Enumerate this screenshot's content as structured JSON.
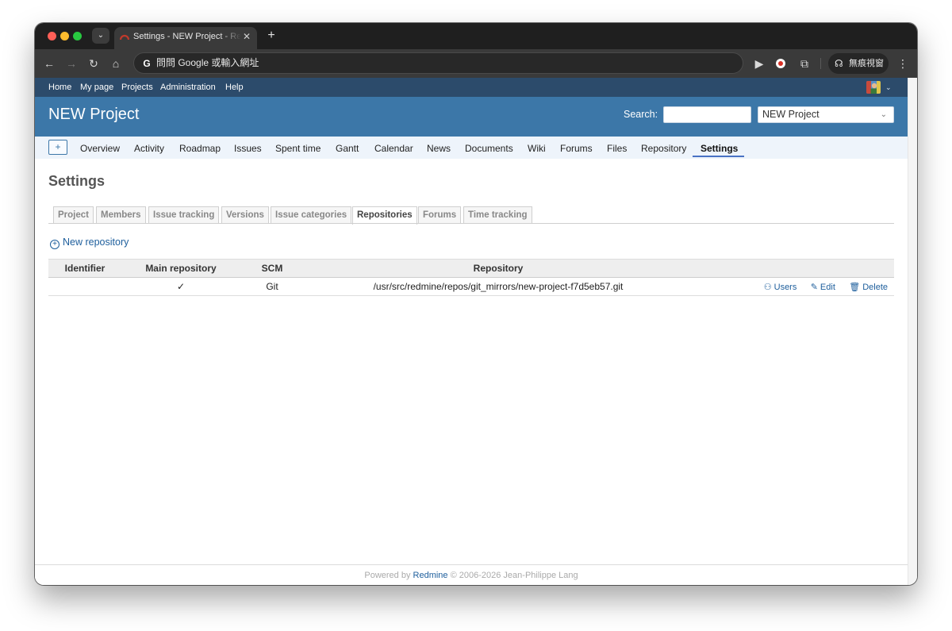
{
  "browser": {
    "tab_title": "Settings - NEW Project - Redmine",
    "tab_close": "✕",
    "new_tab": "+",
    "omnibox_placeholder": "問問 Google 或輸入網址",
    "incognito_label": "無痕視窗"
  },
  "topmenu": {
    "items": [
      "Home",
      "My page",
      "Projects",
      "Administration",
      "Help"
    ]
  },
  "header": {
    "project_title": "NEW Project",
    "search_label": "Search:",
    "search_value": "",
    "project_select_value": "NEW Project"
  },
  "mainmenu": {
    "plus_label": "+",
    "items": [
      "Overview",
      "Activity",
      "Roadmap",
      "Issues",
      "Spent time",
      "Gantt",
      "Calendar",
      "News",
      "Documents",
      "Wiki",
      "Forums",
      "Files",
      "Repository",
      "Settings"
    ],
    "selected": "Settings"
  },
  "content": {
    "title": "Settings",
    "tabs": [
      "Project",
      "Members",
      "Issue tracking",
      "Versions",
      "Issue categories",
      "Repositories",
      "Forums",
      "Time tracking"
    ],
    "selected_tab": "Repositories",
    "new_repository_label": "New repository",
    "table": {
      "headers": [
        "Identifier",
        "Main repository",
        "SCM",
        "Repository",
        ""
      ],
      "rows": [
        {
          "identifier": "",
          "main_repository": "✓",
          "scm": "Git",
          "repository": "/usr/src/redmine/repos/git_mirrors/new-project-f7d5eb57.git",
          "actions": [
            "Users",
            "Edit",
            "Delete"
          ]
        }
      ]
    }
  },
  "footer": {
    "prefix": "Powered by",
    "link": "Redmine",
    "suffix": "© 2006-2026 Jean-Philippe Lang"
  }
}
